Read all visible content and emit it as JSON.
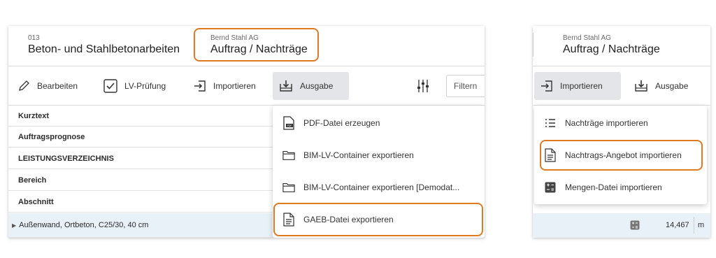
{
  "left": {
    "header": {
      "project_number": "013",
      "project_title": "Beton- und Stahlbetonarbeiten",
      "company": "Bernd Stahl AG",
      "context_title": "Auftrag / Nachträge"
    },
    "toolbar": {
      "edit_label": "Bearbeiten",
      "lv_check_label": "LV-Prüfung",
      "import_label": "Importieren",
      "output_label": "Ausgabe",
      "filter_placeholder": "Filtern"
    },
    "table_rows": [
      "Kurztext",
      "Auftragsprognose",
      "LEISTUNGSVERZEICHNIS",
      "Bereich",
      "Abschnitt",
      "Außenwand, Ortbeton, C25/30, 40 cm"
    ],
    "output_menu": [
      {
        "label": "PDF-Datei erzeugen",
        "icon": "pdf-file-icon"
      },
      {
        "label": "BIM-LV-Container exportieren",
        "icon": "folder-icon"
      },
      {
        "label": "BIM-LV-Container exportieren [Demodat...",
        "icon": "folder-icon"
      },
      {
        "label": "GAEB-Datei exportieren",
        "icon": "document-icon"
      }
    ]
  },
  "right": {
    "header": {
      "company": "Bernd Stahl AG",
      "context_title": "Auftrag / Nachträge"
    },
    "toolbar": {
      "import_label": "Importieren",
      "output_label": "Ausgabe"
    },
    "import_menu": [
      {
        "label": "Nachträge importieren",
        "icon": "list-icon"
      },
      {
        "label": "Nachtrags-Angebot importieren",
        "icon": "document-icon"
      },
      {
        "label": "Mengen-Datei importieren",
        "icon": "calculator-icon"
      }
    ],
    "bottom_row": {
      "value": "14,467",
      "unit": "m"
    }
  },
  "colors": {
    "highlight": "#e07a1f",
    "selected_row": "#e8f1f8",
    "active_button": "#e3e5e8"
  }
}
